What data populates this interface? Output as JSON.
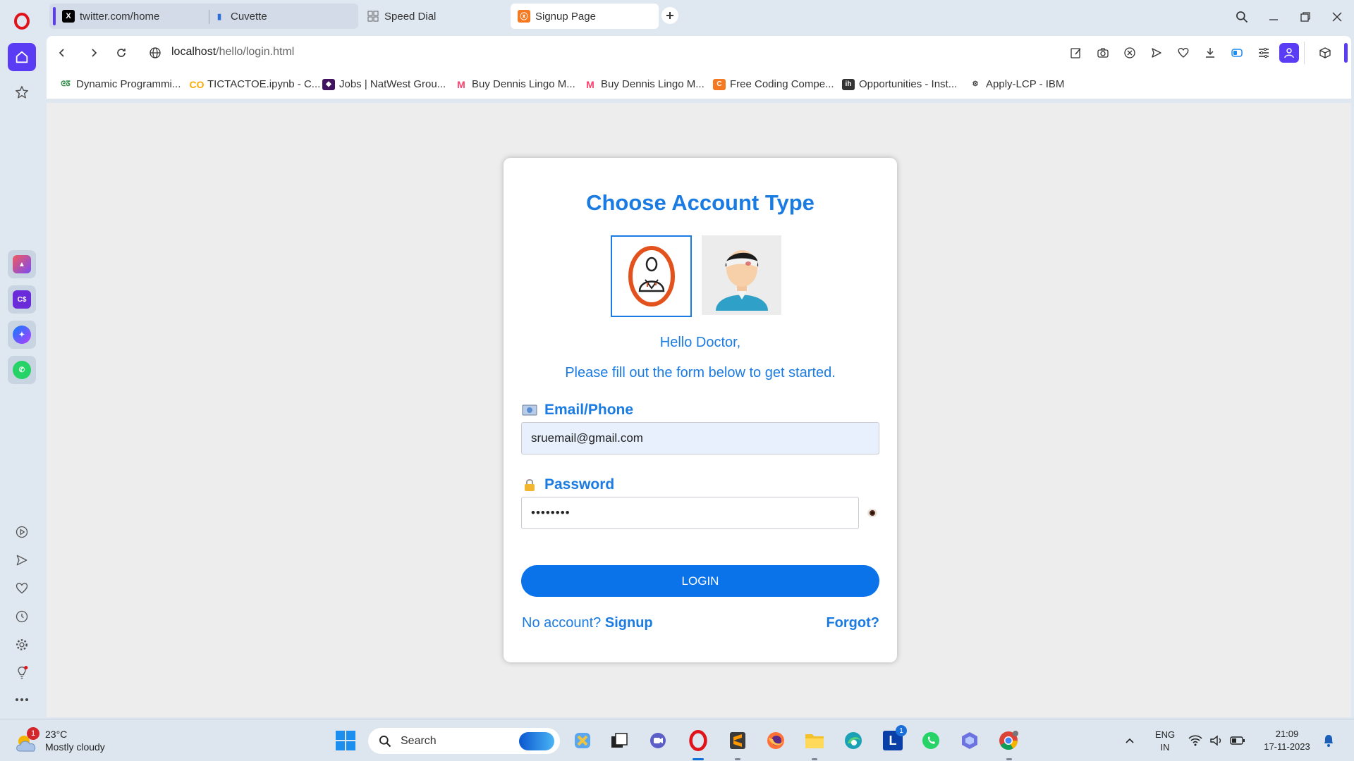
{
  "browser": {
    "tabs": [
      {
        "title": "twitter.com/home",
        "icon": "x-logo-icon"
      },
      {
        "title": "Cuvette",
        "icon": "cuvette-icon"
      },
      {
        "title": "Speed Dial",
        "icon": "speed-dial-icon"
      },
      {
        "title": "Signup Page",
        "icon": "xampp-icon",
        "active": true
      }
    ],
    "url_host": "localhost",
    "url_path": "/hello/login.html",
    "bookmarks": [
      {
        "label": "Dynamic Programmi...",
        "icon": "gfg-icon"
      },
      {
        "label": "TICTACTOE.ipynb - C...",
        "icon": "colab-icon"
      },
      {
        "label": "Jobs | NatWest Grou...",
        "icon": "natwest-icon"
      },
      {
        "label": "Buy Dennis Lingo M...",
        "icon": "myntra-icon"
      },
      {
        "label": "Buy Dennis Lingo M...",
        "icon": "myntra-icon"
      },
      {
        "label": "Free Coding Compe...",
        "icon": "coding-icon"
      },
      {
        "label": "Opportunities - Inst...",
        "icon": "ih-icon"
      },
      {
        "label": "Apply-LCP - IBM",
        "icon": "ibm-icon"
      }
    ]
  },
  "page": {
    "title": "Choose Account Type",
    "account_types": [
      "doctor",
      "patient"
    ],
    "selected_account": "doctor",
    "greeting": "Hello Doctor,",
    "subtitle": "Please fill out the form below to get started.",
    "email_label": "Email/Phone",
    "email_value": "sruemail@gmail.com",
    "password_label": "Password",
    "password_value": "••••••••",
    "login_label": "LOGIN",
    "no_account": "No account?",
    "signup": "Signup",
    "forgot": "Forgot?"
  },
  "taskbar": {
    "weather_temp": "23°C",
    "weather_desc": "Mostly cloudy",
    "weather_badge": "1",
    "search_label": "Search",
    "lang_top": "ENG",
    "lang_bottom": "IN",
    "time": "21:09",
    "date": "17-11-2023",
    "app_badge": "1"
  },
  "colors": {
    "accent": "#1a7be3",
    "button": "#0b73ea",
    "opera_red": "#e0131b",
    "sidebar_active": "#5b3cf5"
  }
}
